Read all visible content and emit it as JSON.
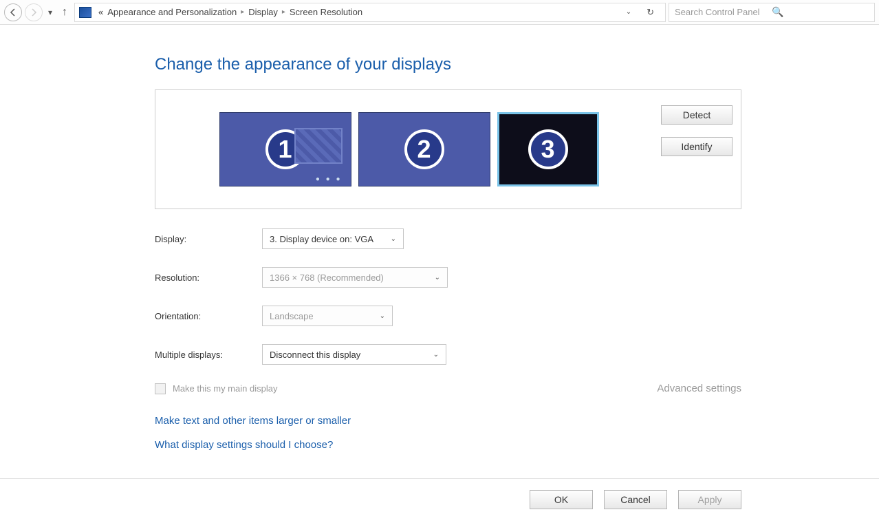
{
  "toolbar": {
    "breadcrumb": [
      "Appearance and Personalization",
      "Display",
      "Screen Resolution"
    ],
    "search_placeholder": "Search Control Panel"
  },
  "page": {
    "title": "Change the appearance of your displays",
    "detect_label": "Detect",
    "identify_label": "Identify",
    "monitors": [
      "1",
      "2",
      "3"
    ]
  },
  "settings": {
    "display_label": "Display:",
    "display_value": "3. Display device on: VGA",
    "resolution_label": "Resolution:",
    "resolution_value": "1366 × 768 (Recommended)",
    "orientation_label": "Orientation:",
    "orientation_value": "Landscape",
    "multiple_label": "Multiple displays:",
    "multiple_value": "Disconnect this display",
    "main_display_label": "Make this my main display",
    "advanced_label": "Advanced settings"
  },
  "links": {
    "link1": "Make text and other items larger or smaller",
    "link2": "What display settings should I choose?"
  },
  "buttons": {
    "ok": "OK",
    "cancel": "Cancel",
    "apply": "Apply"
  }
}
